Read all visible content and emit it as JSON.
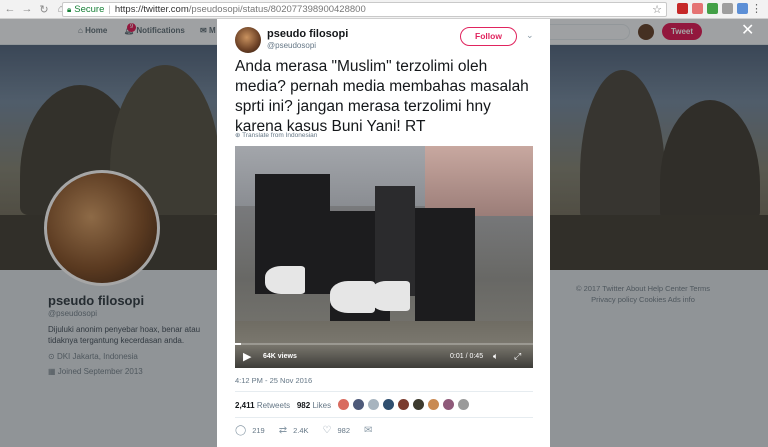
{
  "browser": {
    "secure_label": "Secure",
    "separator": "|",
    "url_host": "https://twitter.com",
    "url_path": "/pseudosopi/status/802077398900428800"
  },
  "twitter_nav": {
    "home_label": "Home",
    "notifications_label": "Notifications",
    "notifications_badge": "9",
    "messages_label": "M",
    "tweet_button_label": "Tweet"
  },
  "profile": {
    "name": "pseudo filosopi",
    "handle": "@pseudosopi",
    "bio": "Dijuluki anonim penyebar hoax, benar atau tidaknya tergantung kecerdasan anda.",
    "location": "DKI Jakarta, Indonesia",
    "joined": "Joined September 2013"
  },
  "footer": {
    "line1": "© 2017 Twitter   About   Help Center   Terms",
    "line2": "Privacy policy   Cookies   Ads info"
  },
  "tweet": {
    "author_name": "pseudo filosopi",
    "author_handle": "@pseudosopi",
    "follow_label": "Follow",
    "text": "Anda merasa \"Muslim\" terzolimi oleh media? pernah media membahas masalah sprti ini? jangan merasa terzolimi hny karena kasus Buni Yani! RT",
    "translate_label": "Translate from Indonesian",
    "video": {
      "views": "64K views",
      "time": "0:01 / 0:45",
      "progress": 0.02
    },
    "timestamp": "4:12 PM - 25 Nov 2016",
    "retweets_count": "2,411",
    "retweets_label": "Retweets",
    "likes_count": "982",
    "likes_label": "Likes",
    "reply_count": "219",
    "retweet_action_count": "2.4K",
    "like_action_count": "982"
  },
  "colors": {
    "accent": "#e0245e",
    "secure_green": "#188038"
  },
  "icons": {
    "back": "back-arrow-icon",
    "forward": "forward-arrow-icon",
    "reload": "reload-icon",
    "home": "home-icon",
    "lock": "lock-icon",
    "star": "star-icon",
    "close": "close-icon",
    "chevron": "chevron-down-icon",
    "play": "play-icon",
    "volume": "volume-icon",
    "fullscreen": "fullscreen-icon",
    "reply": "reply-icon",
    "retweet": "retweet-icon",
    "like": "heart-icon",
    "dm": "envelope-icon"
  }
}
